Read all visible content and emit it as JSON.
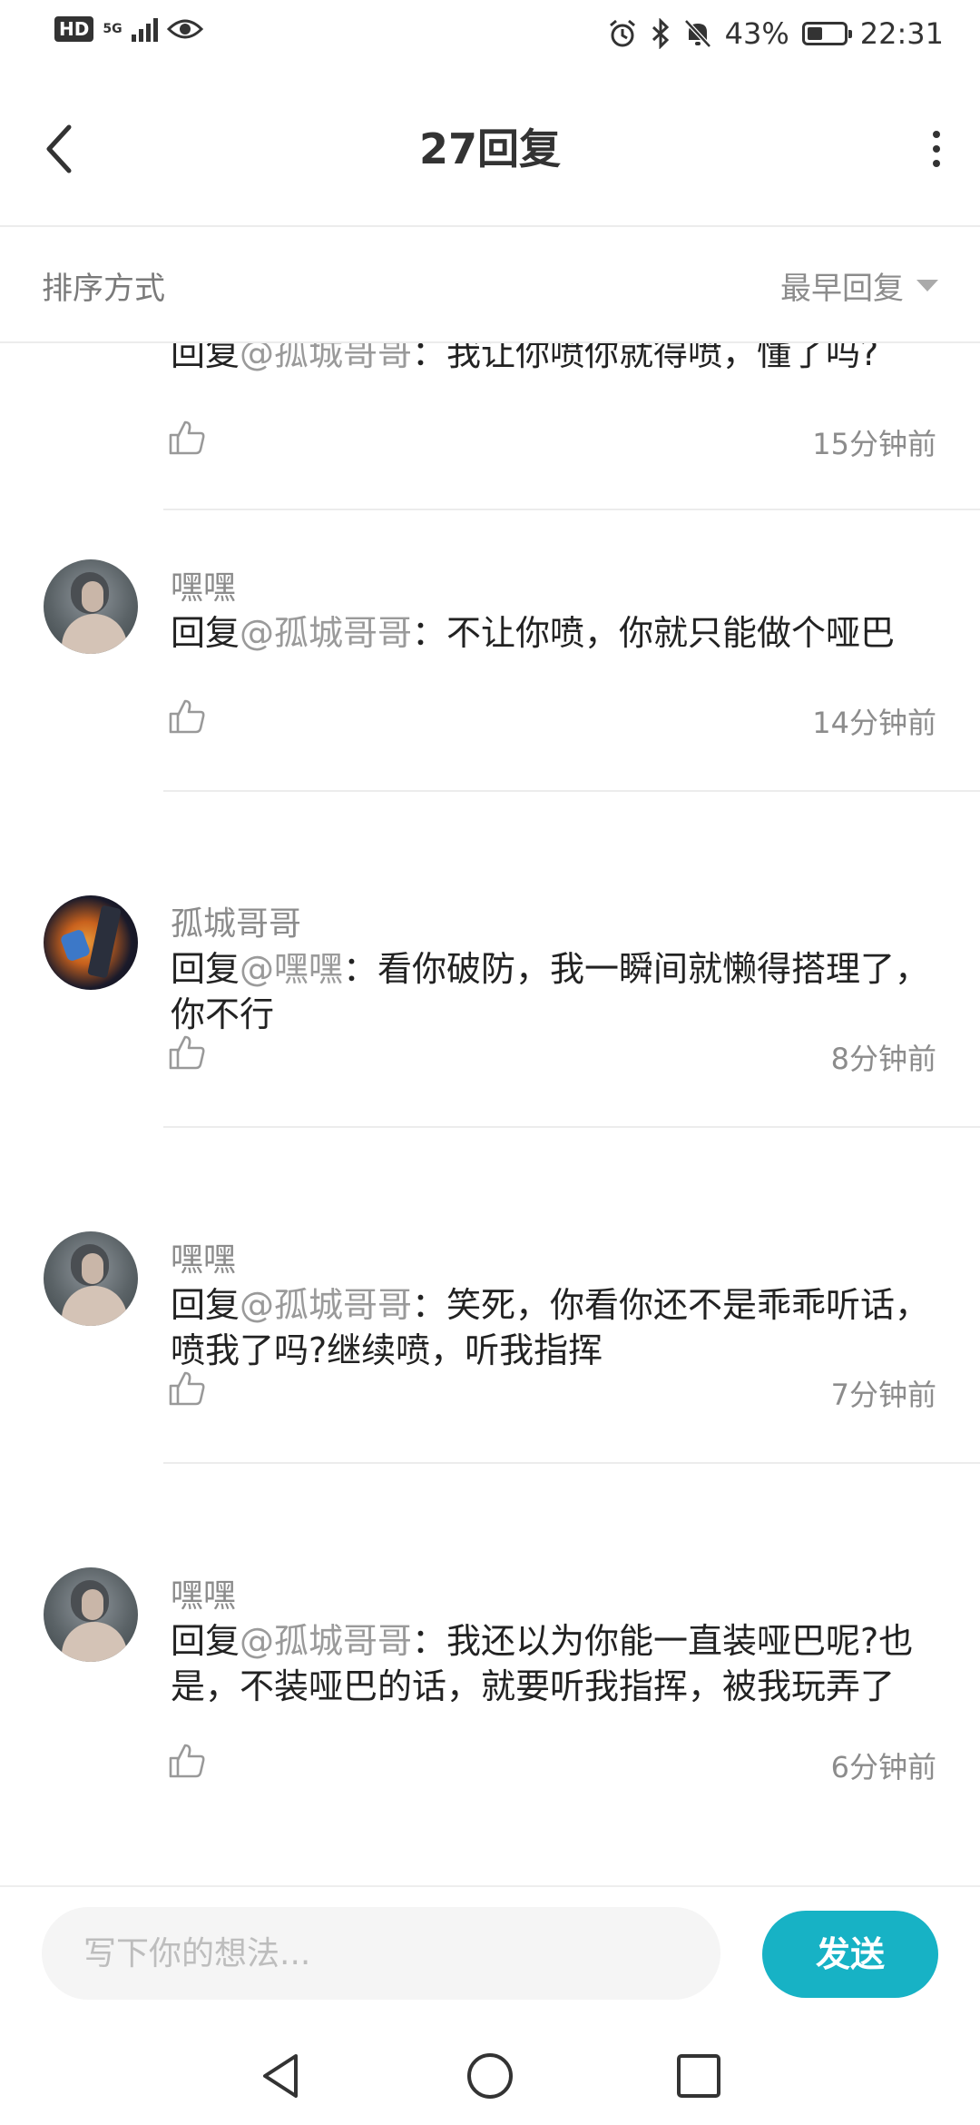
{
  "status_bar": {
    "hd": "HD",
    "network": "5G",
    "battery_text": "43%",
    "battery_level": 0.43,
    "time": "22:31"
  },
  "header": {
    "title": "27回复"
  },
  "sort": {
    "label": "排序方式",
    "selected": "最早回复"
  },
  "comments": [
    {
      "author": "",
      "avatar": "gray",
      "prefix": "回复",
      "mention": "@孤城哥哥",
      "separator": "：",
      "text": "我让你喷你就得喷，懂了吗?",
      "time": "15分钟前"
    },
    {
      "author": "嘿嘿",
      "avatar": "gray",
      "prefix": "回复",
      "mention": "@孤城哥哥",
      "separator": "：",
      "text": "不让你喷，你就只能做个哑巴",
      "time": "14分钟前"
    },
    {
      "author": "孤城哥哥",
      "avatar": "dark",
      "prefix": "回复",
      "mention": "@嘿嘿",
      "separator": "：",
      "text": "看你破防，我一瞬间就懒得搭理了，你不行",
      "time": "8分钟前"
    },
    {
      "author": "嘿嘿",
      "avatar": "gray",
      "prefix": "回复",
      "mention": "@孤城哥哥",
      "separator": "：",
      "text": "笑死，你看你还不是乖乖听话，喷我了吗?继续喷，听我指挥",
      "time": "7分钟前"
    },
    {
      "author": "嘿嘿",
      "avatar": "gray",
      "prefix": "回复",
      "mention": "@孤城哥哥",
      "separator": "：",
      "text": "我还以为你能一直装哑巴呢?也是，不装哑巴的话，就要听我指挥，被我玩弄了",
      "time": "6分钟前"
    }
  ],
  "input": {
    "placeholder": "写下你的想法...",
    "send_label": "发送"
  },
  "colors": {
    "accent": "#17b2c5",
    "mention": "#9a9a9a",
    "text": "#222222",
    "muted": "#8c8c8c"
  }
}
